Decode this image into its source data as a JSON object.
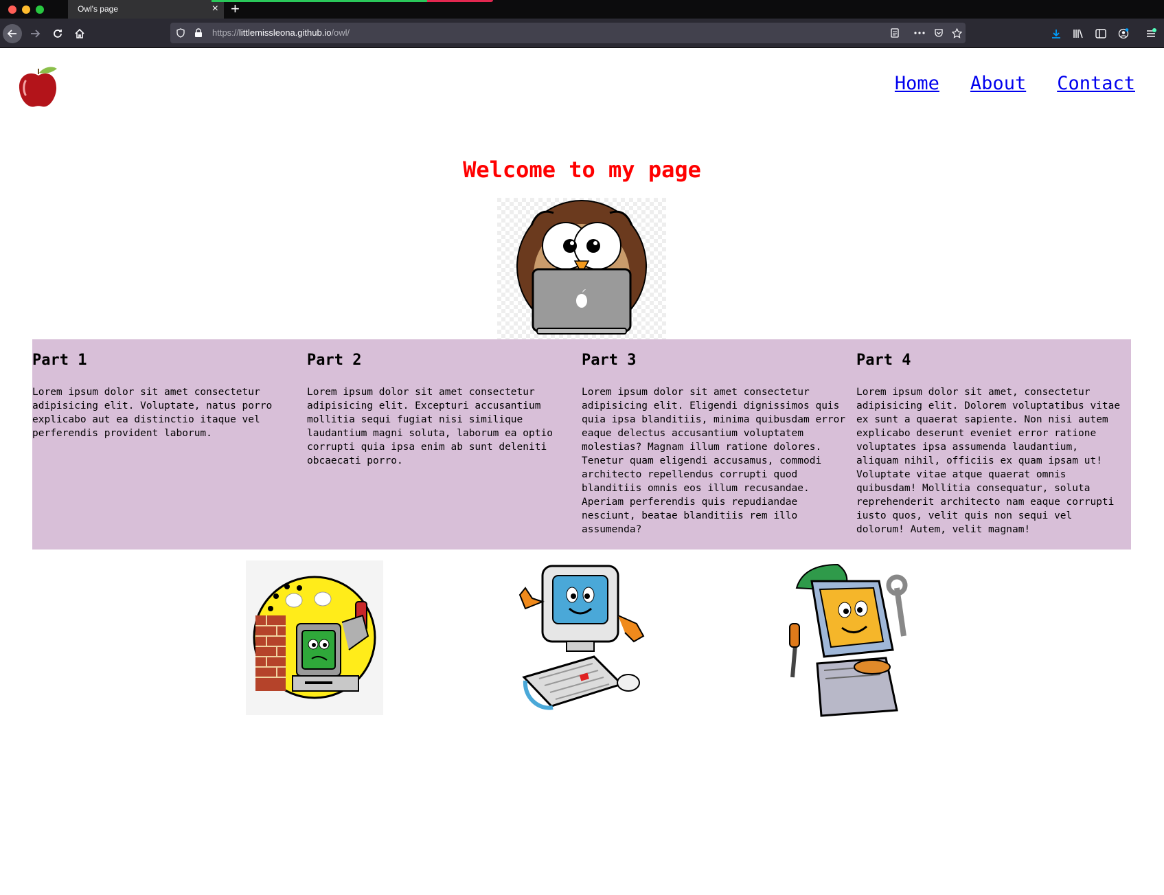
{
  "browser": {
    "tab_title": "Owl's page",
    "tab_close": "×",
    "new_tab": "+",
    "url_scheme": "https://",
    "url_host": "littlemissleona.github.io",
    "url_path": "/owl/"
  },
  "nav": {
    "home": "Home",
    "about": "About",
    "contact": "Contact"
  },
  "welcome": "Welcome to my page",
  "parts": [
    {
      "title": "Part 1",
      "text": "Lorem ipsum dolor sit amet consectetur adipisicing elit. Voluptate, natus porro explicabo aut ea distinctio itaque vel perferendis provident laborum."
    },
    {
      "title": "Part 2",
      "text": "Lorem ipsum dolor sit amet consectetur adipisicing elit. Excepturi accusantium mollitia sequi fugiat nisi similique laudantium magni soluta, laborum ea optio corrupti quia ipsa enim ab sunt deleniti obcaecati porro."
    },
    {
      "title": "Part 3",
      "text": "Lorem ipsum dolor sit amet consectetur adipisicing elit. Eligendi dignissimos quis quia ipsa blanditiis, minima quibusdam error eaque delectus accusantium voluptatem molestias? Magnam illum ratione dolores. Tenetur quam eligendi accusamus, commodi architecto repellendus corrupti quod blanditiis omnis eos illum recusandae. Aperiam perferendis quis repudiandae nesciunt, beatae blanditiis rem illo assumenda?"
    },
    {
      "title": "Part 4",
      "text": "Lorem ipsum dolor sit amet, consectetur adipisicing elit. Dolorem voluptatibus vitae ex sunt a quaerat sapiente. Non nisi autem explicabo deserunt eveniet error ratione voluptates ipsa assumenda laudantium, aliquam nihil, officiis ex quam ipsam ut! Voluptate vitae atque quaerat omnis quibusdam! Mollitia consequatur, soluta reprehenderit architecto nam eaque corrupti iusto quos, velit quis non sequi vel dolorum! Autem, velit magnam!"
    }
  ],
  "colors": {
    "welcome": "#ff0000",
    "parts_background": "#d8bfd8",
    "link": "#0000ee"
  }
}
